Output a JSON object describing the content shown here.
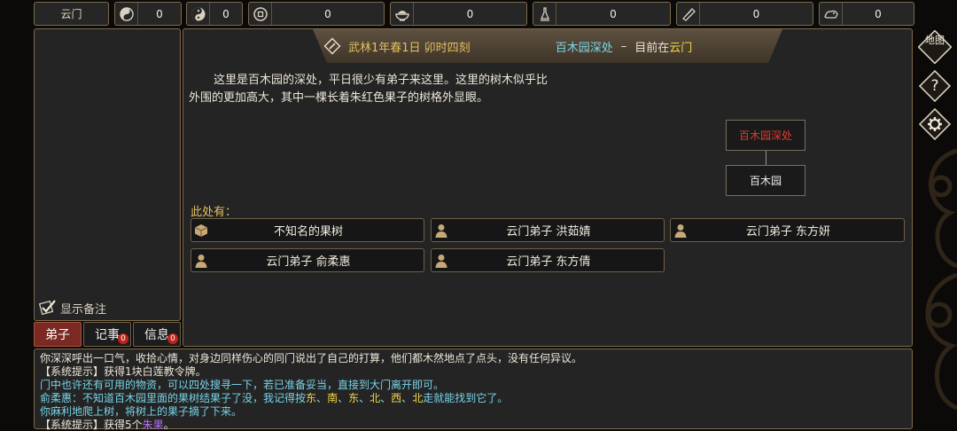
{
  "topbar": {
    "sect_name": "云门",
    "stats": [
      {
        "icon": "yinyang-medal-icon",
        "value": "0"
      },
      {
        "icon": "yinyang-icon",
        "value": "0"
      },
      {
        "icon": "coin-icon",
        "value": "0"
      },
      {
        "icon": "rice-bowl-icon",
        "value": "0"
      },
      {
        "icon": "herb-bottle-icon",
        "value": "0"
      },
      {
        "icon": "scroll-icon",
        "value": "0"
      },
      {
        "icon": "beast-icon",
        "value": "0"
      }
    ]
  },
  "header": {
    "date": "武林1年春1日 卯时四刻",
    "location": "百木园深处",
    "separator": "–",
    "current_prefix": "目前在",
    "current_place": "云门"
  },
  "description": {
    "line1": "这里是百木园的深处，平日很少有弟子来这里。这里的树木似乎比",
    "line2": "外围的更加高大，其中一棵长着朱红色果子的树格外显眼。"
  },
  "map": {
    "current": "百木园深处",
    "linked": "百木园"
  },
  "here": {
    "label": "此处有：",
    "items": [
      {
        "icon": "box-icon",
        "label": "不知名的果树"
      },
      {
        "icon": "person-icon",
        "label": "云门弟子  洪茹婧"
      },
      {
        "icon": "person-icon",
        "label": "云门弟子  东方妍"
      },
      {
        "icon": "person-icon",
        "label": "云门弟子  俞柔惠"
      },
      {
        "icon": "person-icon",
        "label": "云门弟子  东方倩"
      }
    ]
  },
  "left": {
    "show_notes": "显示备注"
  },
  "tabs": [
    {
      "label": "弟子",
      "badge": ""
    },
    {
      "label": "记事",
      "badge": "0"
    },
    {
      "label": "信息",
      "badge": "0"
    }
  ],
  "side": {
    "map_label": "地图",
    "help": "?"
  },
  "log": {
    "l1": "你深深呼出一口气，收拾心情，对身边同样伤心的同门说出了自己的打算，他们都木然地点了点头，没有任何异议。",
    "l2": "【系统提示】获得1块白莲教令牌。",
    "l3": "门中也许还有可用的物资，可以四处搜寻一下，若已准备妥当，直接到大门离开即可。",
    "l4_speaker": "俞柔惠：",
    "l4_a": "不知道百木园里面的果树结果子了没，我记得按",
    "l4_dirs": [
      "东",
      "南",
      "东",
      "北",
      "西",
      "北"
    ],
    "l4_sep": "、",
    "l4_b": "走就能找到它了。",
    "l5": "你麻利地爬上树，将树上的果子摘了下来。",
    "l6_a": "【系统提示】获得5个",
    "l6_item": "朱果",
    "l6_b": "。"
  },
  "colors": {
    "accent_gold": "#e3bf5e",
    "location_cyan": "#7fd6e8",
    "log_cyan": "#78d4e8",
    "highlight_yellow": "#f1d64a",
    "item_purple": "#b66cff",
    "map_red": "#e23b2a",
    "tab_active": "#7a2a22",
    "badge_red": "#c0241b"
  }
}
